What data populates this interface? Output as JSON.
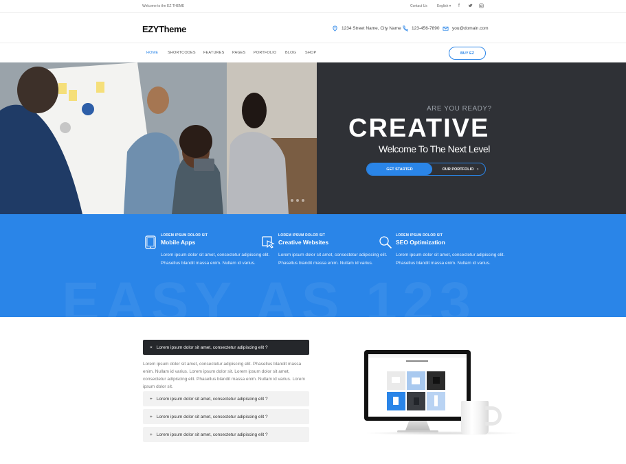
{
  "topbar": {
    "welcome": "Welcome to the EZ THEME",
    "contact": "Contact Us",
    "language": "English ▾",
    "social_icons": [
      "facebook-icon",
      "twitter-icon",
      "instagram-icon"
    ]
  },
  "header": {
    "logo": "EZYTheme",
    "address": "1234 Street Name, City Name",
    "phone": "123-456-7890",
    "email": "you@domain.com"
  },
  "nav": {
    "items": [
      "HOME",
      "SHORTCODES",
      "FEATURES",
      "PAGES",
      "PORTFOLIO",
      "BLOG",
      "SHOP"
    ],
    "active": "HOME",
    "buy_label": "BUY EZ"
  },
  "hero": {
    "kicker": "ARE YOU READY?",
    "title": "CREATIVE",
    "subtitle": "Welcome To The Next Level",
    "primary_button": "GET STARTED",
    "secondary_button": "OUR PORTFOLIO"
  },
  "features": {
    "background_text": "EASY AS 123",
    "items": [
      {
        "icon": "tablet-icon",
        "kicker": "LOREM IPSUM DOLOR SIT",
        "title": "Mobile Apps",
        "desc": "Lorem ipsum dolor sit amet, consectetur adipiscing elit. Phasellus blandit massa enim. Nullam id varius."
      },
      {
        "icon": "cursor-icon",
        "kicker": "LOREM IPSUM DOLOR SIT",
        "title": "Creative Websites",
        "desc": "Lorem ipsum dolor sit amet, consectetur adipiscing elit. Phasellus blandit massa enim. Nullam id varius."
      },
      {
        "icon": "search-icon",
        "kicker": "LOREM IPSUM DOLOR SIT",
        "title": "SEO Optimization",
        "desc": "Lorem ipsum dolor sit amet, consectetur adipiscing elit. Phasellus blandit massa enim. Nullam id varius."
      }
    ]
  },
  "accordion": {
    "open_title": "Lorem ipsum dolor sit amet, consectetur adipiscing elit ?",
    "open_body": "Lorem ipsum dolor sit amet, consectetur adipiscing elit. Phasellus blandit massa enim. Nullam id varius. Lorem ipsum dolor sit. Lorem ipsum dolor sit amet, consectetur adipiscing elit. Phasellus blandit massa enim. Nullam id varius. Lorem ipsum dolor sit.",
    "items": [
      "Lorem ipsum dolor sit amet, consectetur adipiscing elit ?",
      "Lorem ipsum dolor sit amet, consectetur adipiscing elit ?",
      "Lorem ipsum dolor sit amet, consectetur adipiscing elit ?"
    ]
  },
  "colors": {
    "accent": "#2a85e8",
    "hero_dark": "#2f3136",
    "accordion_dark": "#25272b"
  }
}
